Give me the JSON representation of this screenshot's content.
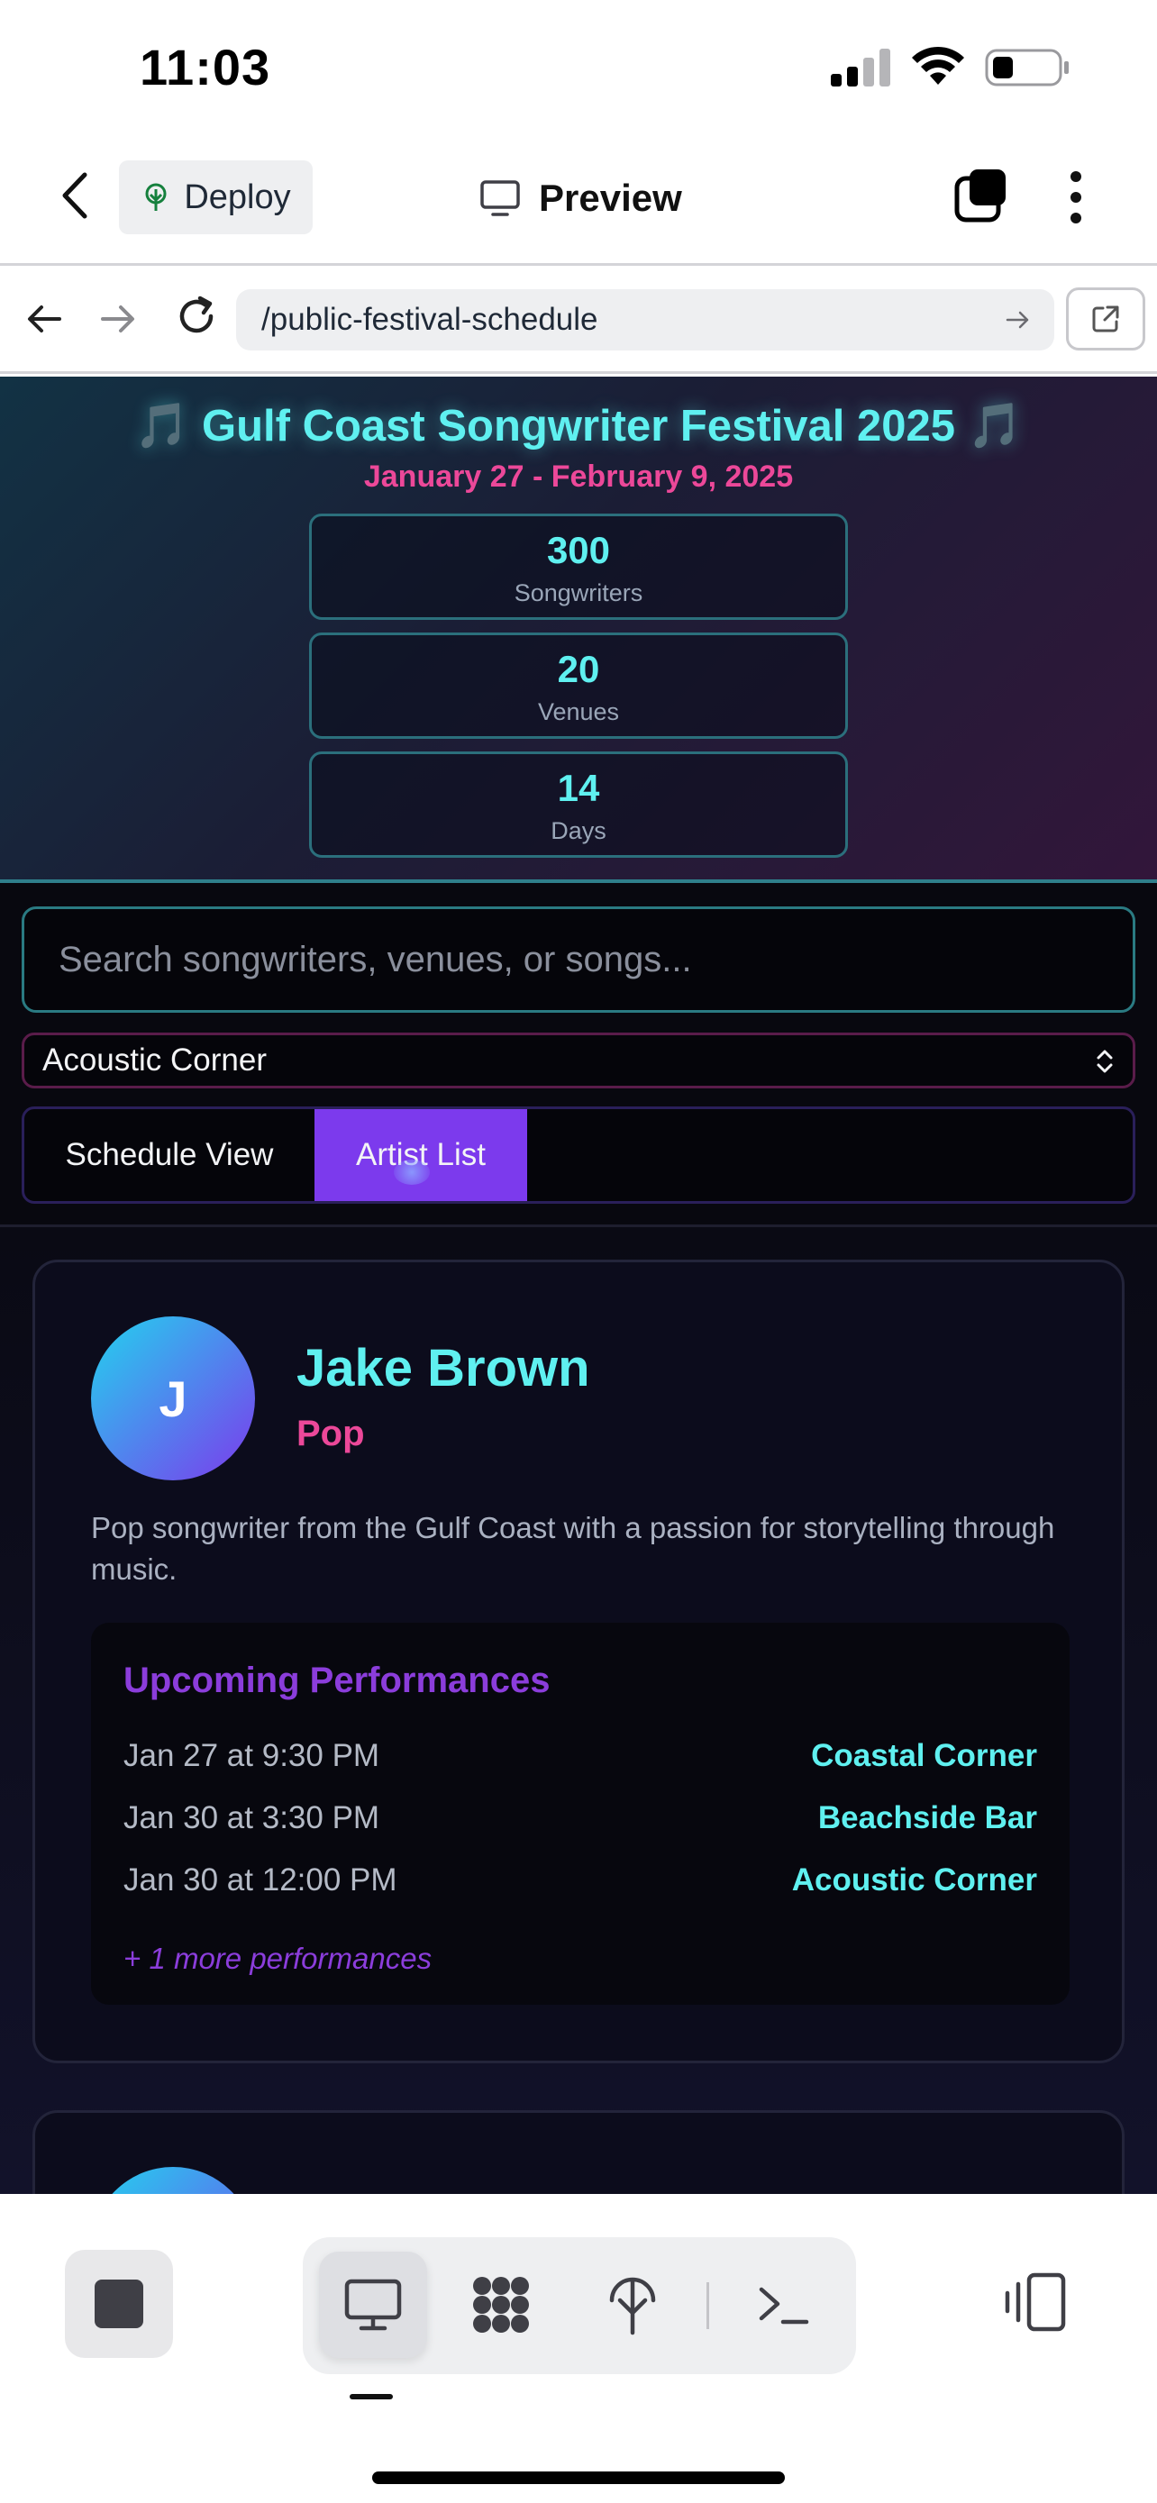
{
  "status_bar": {
    "time": "11:03"
  },
  "app_header": {
    "deploy_label": "Deploy",
    "preview_label": "Preview"
  },
  "browser": {
    "url": "/public-festival-schedule"
  },
  "festival": {
    "title": "🎵 Gulf Coast Songwriter Festival 2025 🎵",
    "dates": "January 27 - February 9, 2025",
    "stats": [
      {
        "value": "300",
        "label": "Songwriters"
      },
      {
        "value": "20",
        "label": "Venues"
      },
      {
        "value": "14",
        "label": "Days"
      }
    ]
  },
  "controls": {
    "search_placeholder": "Search songwriters, venues, or songs...",
    "venue_selected": "Acoustic Corner",
    "tabs": [
      {
        "label": "Schedule View",
        "active": false
      },
      {
        "label": "Artist List",
        "active": true
      }
    ]
  },
  "artists": [
    {
      "initial": "J",
      "name": "Jake Brown",
      "genre": "Pop",
      "bio": "Pop songwriter from the Gulf Coast with a passion for storytelling through music.",
      "performances_heading": "Upcoming Performances",
      "performances": [
        {
          "when": "Jan 27 at 9:30 PM",
          "venue": "Coastal Corner"
        },
        {
          "when": "Jan 30 at 3:30 PM",
          "venue": "Beachside Bar"
        },
        {
          "when": "Jan 30 at 12:00 PM",
          "venue": "Acoustic Corner"
        }
      ],
      "more": "+ 1 more performances"
    }
  ],
  "colors": {
    "accent_cyan": "#5ff0f0",
    "accent_pink": "#ec4899",
    "accent_purple": "#7c3aed",
    "background": "#0a0a14"
  },
  "icons": {
    "back": "chevron-left-icon",
    "deploy": "deploy-tree-icon",
    "preview": "monitor-icon",
    "tabs": "tabs-icon",
    "more": "kebab-icon",
    "nav_back": "arrow-left-icon",
    "nav_forward": "arrow-right-icon",
    "reload": "reload-icon",
    "external": "external-link-icon",
    "stop": "stop-icon",
    "apps": "apps-grid-icon",
    "shell": "terminal-icon",
    "device": "device-toggle-icon"
  }
}
